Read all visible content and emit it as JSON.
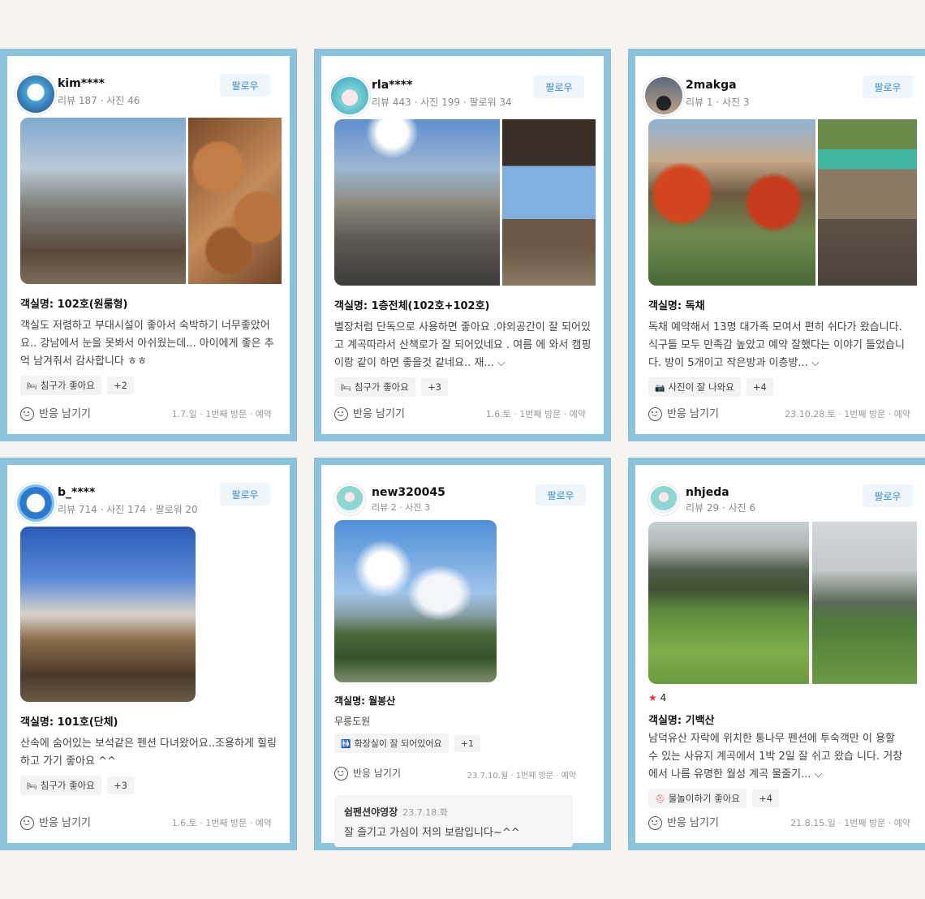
{
  "follow_label": "팔로우",
  "react_label": "반응 남기기",
  "reviews": [
    {
      "user": "kim****",
      "meta": "리뷰 187 · 사진 46",
      "room": "객실명: 102호(원룸형)",
      "text": "객실도 저렴하고 부대시설이 좋아서 숙박하기 너무좋았어요.. 강남에서 눈을 못봐서 아쉬웠는데... 아이에게 좋은 추억 남겨줘서 감사합니다 ㅎㅎ",
      "tag": "침구가 좋아요",
      "tag_icon": "bed-icon",
      "more": "+2",
      "visit": "1.7.일 · 1번째 방문 · 예약"
    },
    {
      "user": "rla****",
      "meta": "리뷰 443 · 사진 199 · 팔로워 34",
      "room": "객실명: 1층전체(102호+102호)",
      "text": "별장처럼 단독으로 사용하면 좋아요 .야외공간이 잘 되어있고 계곡따라서 산책로가 잘 되어있네요 . 여름 에 와서 캠핑이랑 같이 하면 좋을것 같네요.. 재... ⌵",
      "tag": "침구가 좋아요",
      "tag_icon": "bed-icon",
      "more": "+3",
      "visit": "1.6.토 · 1번째 방문 · 예약"
    },
    {
      "user": "2makga",
      "meta": "리뷰 1 · 사진 3",
      "room": "객실명: 독채",
      "text": "독채 예약해서 13명 대가족 모여서 편히 쉬다가 왔습니다. 식구들 모두 만족감 높았고 예약 잘했다는 이야기 들었습니다. 방이 5개이고 작은방과 이층방... ⌵",
      "tag": "사진이 잘 나와요",
      "tag_icon": "camera-icon",
      "more": "+4",
      "visit": "23.10.28.토 · 1번째 방문 · 예약"
    },
    {
      "user": "b_****",
      "meta": "리뷰 714 · 사진 174 · 팔로워 20",
      "room": "객실명: 101호(단체)",
      "text": "산속에 숨어있는 보석같은 펜션 다녀왔어요..조용하게 힐링하고 가기 좋아요 ^^",
      "tag": "침구가 좋아요",
      "tag_icon": "bed-icon",
      "more": "+3",
      "visit": "1.6.토 · 1번째 방문 · 예약"
    },
    {
      "user": "new320045",
      "meta": "리뷰 2 · 사진 3",
      "room": "객실명: 월봉산",
      "text": "무릉도원",
      "tag": "화장실이 잘 되어있어요",
      "tag_icon": "restroom-icon",
      "more": "+1",
      "visit": "23.7.10.월 · 1번째 방문 · 예약",
      "reply_name": "쉼펜션야영장",
      "reply_date": "23.7.18.화",
      "reply_text": "잘 즐기고 가심이 저의 보람입니다~^^"
    },
    {
      "user": "nhjeda",
      "meta": "리뷰 29 · 사진 6",
      "rating": "4",
      "room": "객실명: 기백산",
      "text": "남덕유산 자락에 위치한 통나무 펜션에 투숙객만 이 용할 수 있는 사유지 계곡에서 1박 2일 잘 쉬고 왔습 니다. 거창에서 나름 유명한 월성 계곡 물줄기... ⌵",
      "tag": "물놀이하기 좋아요",
      "tag_icon": "lifebuoy-icon",
      "more": "+4",
      "visit": "21.8.15.일 · 1번째 방문 · 예약"
    }
  ]
}
